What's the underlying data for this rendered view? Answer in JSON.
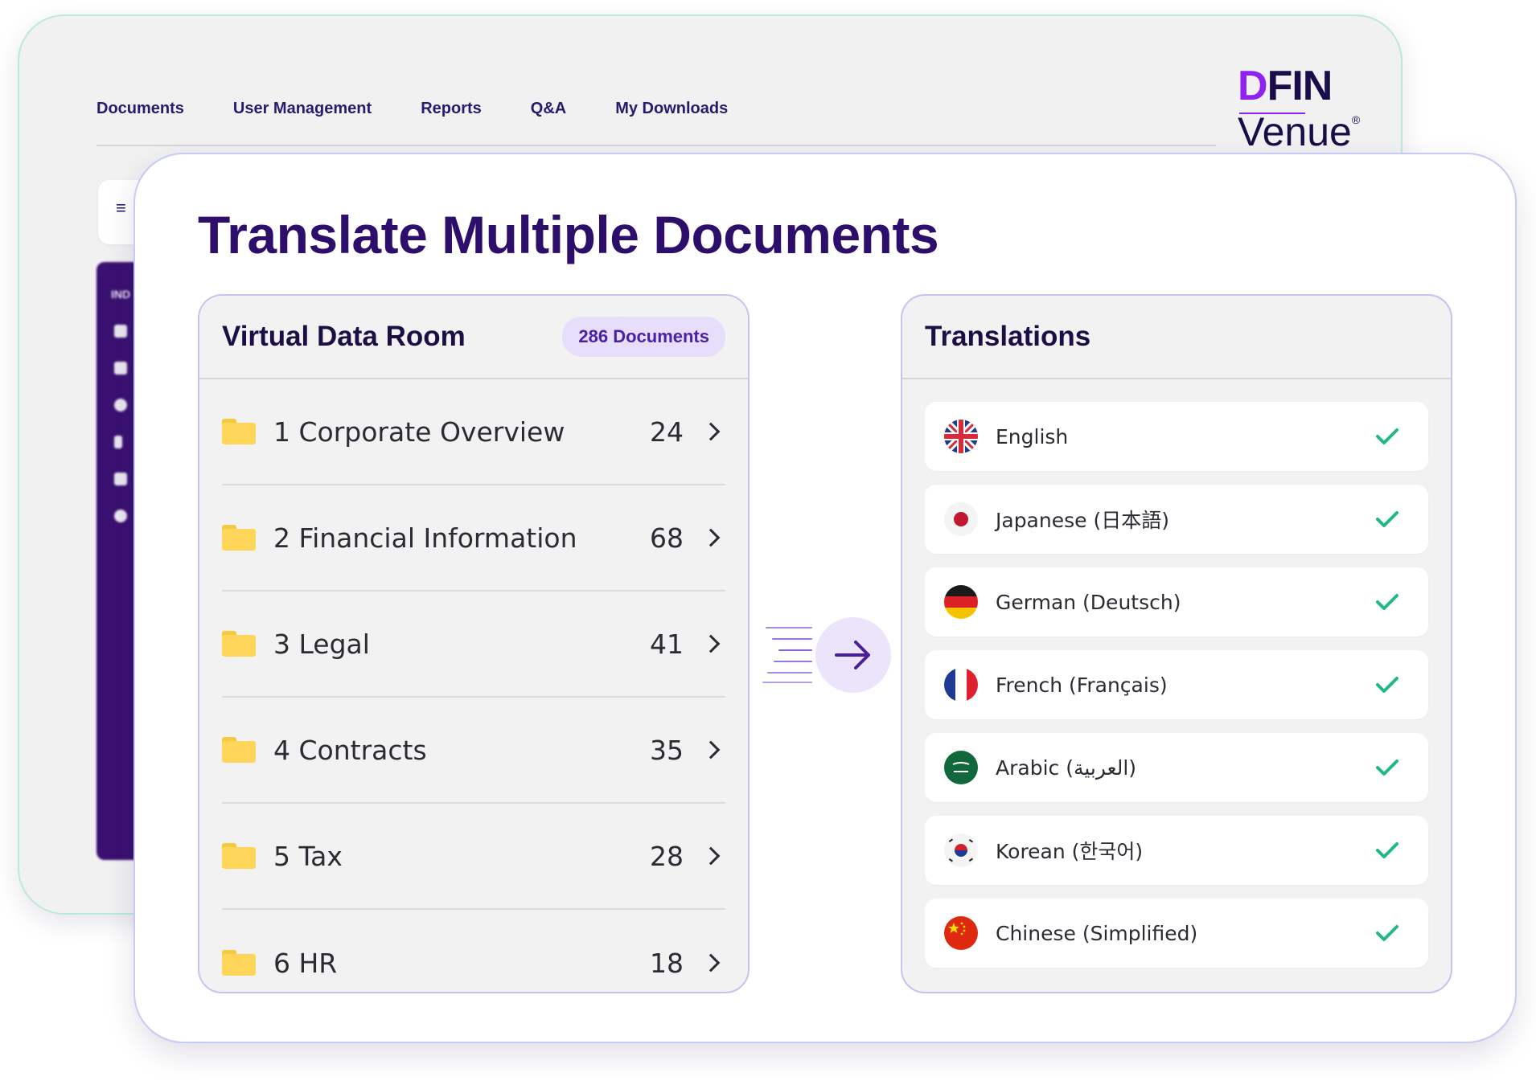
{
  "back_window": {
    "nav": [
      "Documents",
      "User Management",
      "Reports",
      "Q&A",
      "My Downloads"
    ],
    "brand": {
      "dfin": "DFIN",
      "venue": "Venue",
      "registered": "®"
    },
    "sidebar_label": "IND"
  },
  "title": "Translate Multiple Documents",
  "vdr": {
    "title": "Virtual Data Room",
    "badge": "286 Documents",
    "folders": [
      {
        "name": "1 Corporate Overview",
        "count": "24"
      },
      {
        "name": "2 Financial Information",
        "count": "68"
      },
      {
        "name": "3 Legal",
        "count": "41"
      },
      {
        "name": "4 Contracts",
        "count": "35"
      },
      {
        "name": "5 Tax",
        "count": "28"
      },
      {
        "name": "6 HR",
        "count": "18"
      }
    ]
  },
  "translations": {
    "title": "Translations",
    "languages": [
      {
        "name": "English",
        "flag": "uk-flag-icon",
        "done": true
      },
      {
        "name": "Japanese (日本語)",
        "flag": "japan-flag-icon",
        "done": true
      },
      {
        "name": "German (Deutsch)",
        "flag": "germany-flag-icon",
        "done": true
      },
      {
        "name": "French (Français)",
        "flag": "france-flag-icon",
        "done": true
      },
      {
        "name": "Arabic (العربية)",
        "flag": "saudi-flag-icon",
        "done": true
      },
      {
        "name": "Korean (한국어)",
        "flag": "korea-flag-icon",
        "done": true
      },
      {
        "name": "Chinese (Simplified)",
        "flag": "china-flag-icon",
        "done": true
      }
    ]
  },
  "colors": {
    "brand_purple": "#2d0e6b",
    "accent_violet": "#8e23f0",
    "check_green": "#1fb889",
    "folder_yellow": "#ffd659"
  }
}
